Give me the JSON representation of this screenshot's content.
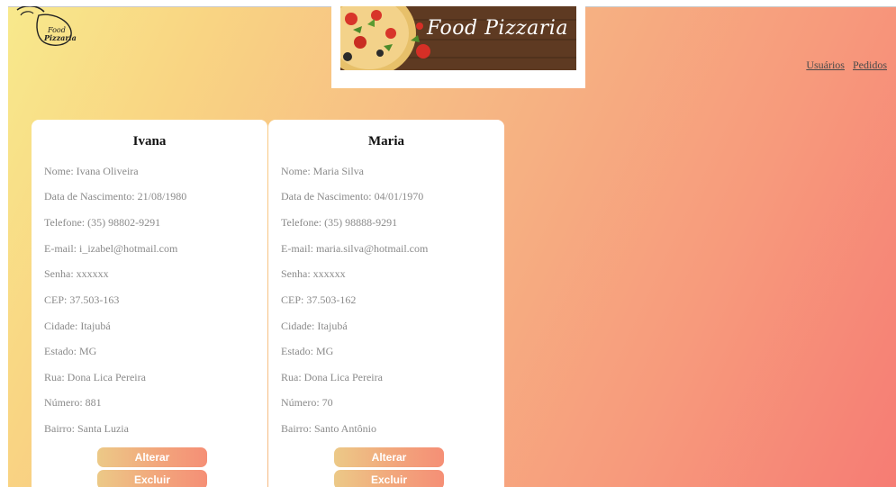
{
  "header": {
    "logo_text_1": "Food",
    "logo_text_2": "Pizzaria",
    "banner_title": "Food Pizzaria",
    "top_cut": "── ────── ─"
  },
  "nav": {
    "usuarios": "Usuários",
    "pedidos": "Pedidos"
  },
  "cards": [
    {
      "name": "Ivana",
      "fields": [
        "Nome: Ivana Oliveira",
        "Data de Nascimento: 21/08/1980",
        "Telefone: (35) 98802-9291",
        "E-mail: i_izabel@hotmail.com",
        "Senha: xxxxxx",
        "CEP: 37.503-163",
        "Cidade: Itajubá",
        "Estado: MG",
        "Rua: Dona Lica Pereira",
        "Número: 881",
        "Bairro: Santa Luzia"
      ],
      "alterar": "Alterar",
      "excluir": "Excluir"
    },
    {
      "name": "Maria",
      "fields": [
        "Nome: Maria Silva",
        "Data de Nascimento: 04/01/1970",
        "Telefone: (35) 98888-9291",
        "E-mail: maria.silva@hotmail.com",
        "Senha: xxxxxx",
        "CEP: 37.503-162",
        "Cidade: Itajubá",
        "Estado: MG",
        "Rua: Dona Lica Pereira",
        "Número: 70",
        "Bairro: Santo Antônio"
      ],
      "alterar": "Alterar",
      "excluir": "Excluir"
    }
  ]
}
